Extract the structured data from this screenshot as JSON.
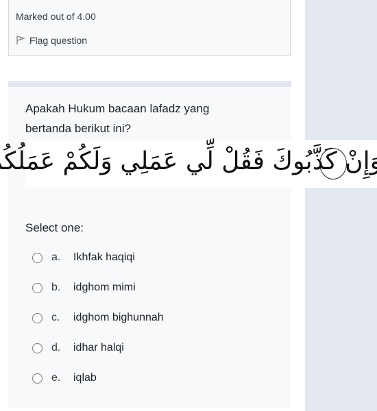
{
  "info": {
    "marked_out": "Marked out of 4.00",
    "flag_label": "Flag question",
    "flag_icon": "flag-icon"
  },
  "question": {
    "text": "Apakah Hukum bacaan lafadz yang bertanda berikut ini?",
    "arabic": "وَإِنْ كَذَّبُوكَ فَقُلْ لِّي عَمَلِي وَلَكُمْ عَمَلُكُمْ",
    "prompt": "Select one:",
    "options": [
      {
        "letter": "a.",
        "text": "Ikhfak haqiqi"
      },
      {
        "letter": "b.",
        "text": "idghom mimi"
      },
      {
        "letter": "c.",
        "text": "idghom bighunnah"
      },
      {
        "letter": "d.",
        "text": "idhar halqi"
      },
      {
        "letter": "e.",
        "text": "iqlab"
      }
    ]
  },
  "colors": {
    "sidebar": "#e3e8f1",
    "card": "#f7f9fb",
    "band": "#e2e7ef"
  }
}
